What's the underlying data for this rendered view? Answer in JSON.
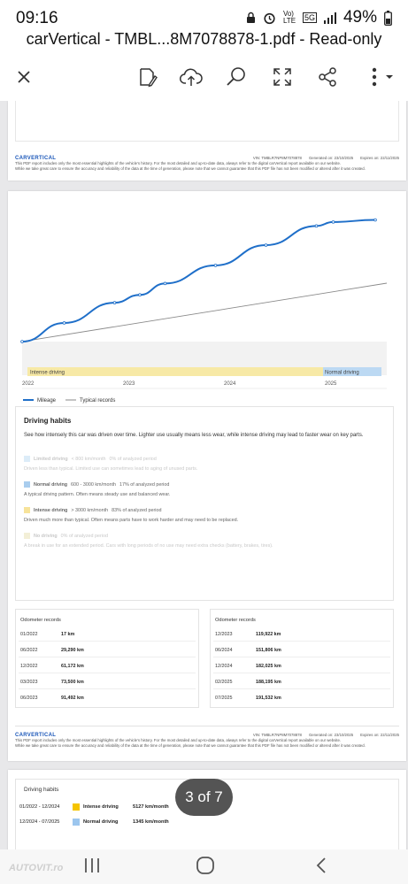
{
  "status": {
    "time": "09:16",
    "network": "5G",
    "lte": "Vo) LTE",
    "battery": "49%"
  },
  "app": {
    "title": "carVertical - TMBL...8M7078878-1.pdf - Read-only"
  },
  "toolbar": {
    "close_icon": "close-icon",
    "edit_icon": "draw-icon",
    "upload_icon": "cloud-upload-icon",
    "search_icon": "search-icon",
    "expand_icon": "expand-icon",
    "share_icon": "share-icon",
    "more_icon": "more-vertical-icon"
  },
  "pdf_footer": {
    "logo": "CARVERTICAL",
    "line1": "This PDF report includes only the most essential highlights of the vehicle's history. For the most detailed and up-to-date data, always refer to the digital carVertical report available on our website.",
    "line2": "While we take great care to ensure the accuracy and reliability of the data at the time of generation, please note that we cannot guarantee that this PDF file has not been modified or altered after it was created.",
    "vin": "VIN: TMBLR7NP8M7078878",
    "generated": "Generated on: 23/10/2025",
    "expires": "Expires on: 22/11/2025"
  },
  "chart": {
    "x_ticks": [
      "2022",
      "2023",
      "2024",
      "2025"
    ],
    "bands": [
      {
        "label": "Intense driving",
        "color": "#f7e9a6"
      },
      {
        "label": "Normal driving",
        "color": "#bcd9f3"
      }
    ],
    "legend": {
      "mileage": "Mileage",
      "typical": "Typical records"
    }
  },
  "chart_data": {
    "type": "line",
    "x_ticks": [
      "2022",
      "2023",
      "2024",
      "2025"
    ],
    "series": [
      {
        "name": "Mileage",
        "color": "#1f6fc9",
        "points": [
          [
            "01/2022",
            17
          ],
          [
            "06/2022",
            29290
          ],
          [
            "12/2022",
            61172
          ],
          [
            "03/2023",
            73500
          ],
          [
            "06/2023",
            91492
          ],
          [
            "12/2023",
            119922
          ],
          [
            "06/2024",
            151806
          ],
          [
            "12/2024",
            182025
          ],
          [
            "02/2025",
            188195
          ],
          [
            "07/2025",
            191532
          ]
        ]
      },
      {
        "name": "Typical records",
        "color": "#8a8a8a",
        "trend": "linear"
      }
    ]
  },
  "habits": {
    "title": "Driving habits",
    "description": "See how intensely this car was driven over time. Lighter use usually means less wear, while intense driving may lead to faster wear on key parts.",
    "items": [
      {
        "name": "Limited driving",
        "range": "< 800 km/month",
        "pct": "0% of analyzed period",
        "desc": "Driven less than typical. Limited use can sometimes lead to aging of unused parts.",
        "color": "#dcecf8",
        "active": false
      },
      {
        "name": "Normal driving",
        "range": "600 - 3000 km/month",
        "pct": "17% of analyzed period",
        "desc": "A typical driving pattern. Often means steady use and balanced wear.",
        "color": "#a9cdee",
        "active": true
      },
      {
        "name": "Intense driving",
        "range": "> 3000 km/month",
        "pct": "83% of analyzed period",
        "desc": "Driven much more than typical. Often means parts have to work harder and may need to be replaced.",
        "color": "#f7e39a",
        "active": true
      },
      {
        "name": "No driving",
        "range": "",
        "pct": "0% of analyzed period",
        "desc": "A break in use for an extended period. Cars with long periods of no use may need extra checks (battery, brakes, tires).",
        "color": "#f3efd7",
        "active": false
      }
    ]
  },
  "odometer": {
    "header": "Odometer records",
    "left": [
      {
        "date": "01/2022",
        "value": "17 km"
      },
      {
        "date": "06/2022",
        "value": "29,290 km"
      },
      {
        "date": "12/2022",
        "value": "61,172 km"
      },
      {
        "date": "03/2023",
        "value": "73,500 km"
      },
      {
        "date": "06/2023",
        "value": "91,492 km"
      }
    ],
    "right": [
      {
        "date": "12/2023",
        "value": "119,922 km"
      },
      {
        "date": "06/2024",
        "value": "151,806 km"
      },
      {
        "date": "12/2024",
        "value": "182,025 km"
      },
      {
        "date": "02/2025",
        "value": "188,195 km"
      },
      {
        "date": "07/2025",
        "value": "191,532 km"
      }
    ]
  },
  "next_page": {
    "title": "Driving habits",
    "rows": [
      {
        "period": "01/2022 - 12/2024",
        "label": "Intense driving",
        "value": "5127 km/month",
        "color": "#f5c400"
      },
      {
        "period": "12/2024 - 07/2025",
        "label": "Normal driving",
        "value": "1345 km/month",
        "color": "#9cc6ee"
      }
    ]
  },
  "page_indicator": "3 of 7",
  "watermark": "AUTOVIT.ro"
}
